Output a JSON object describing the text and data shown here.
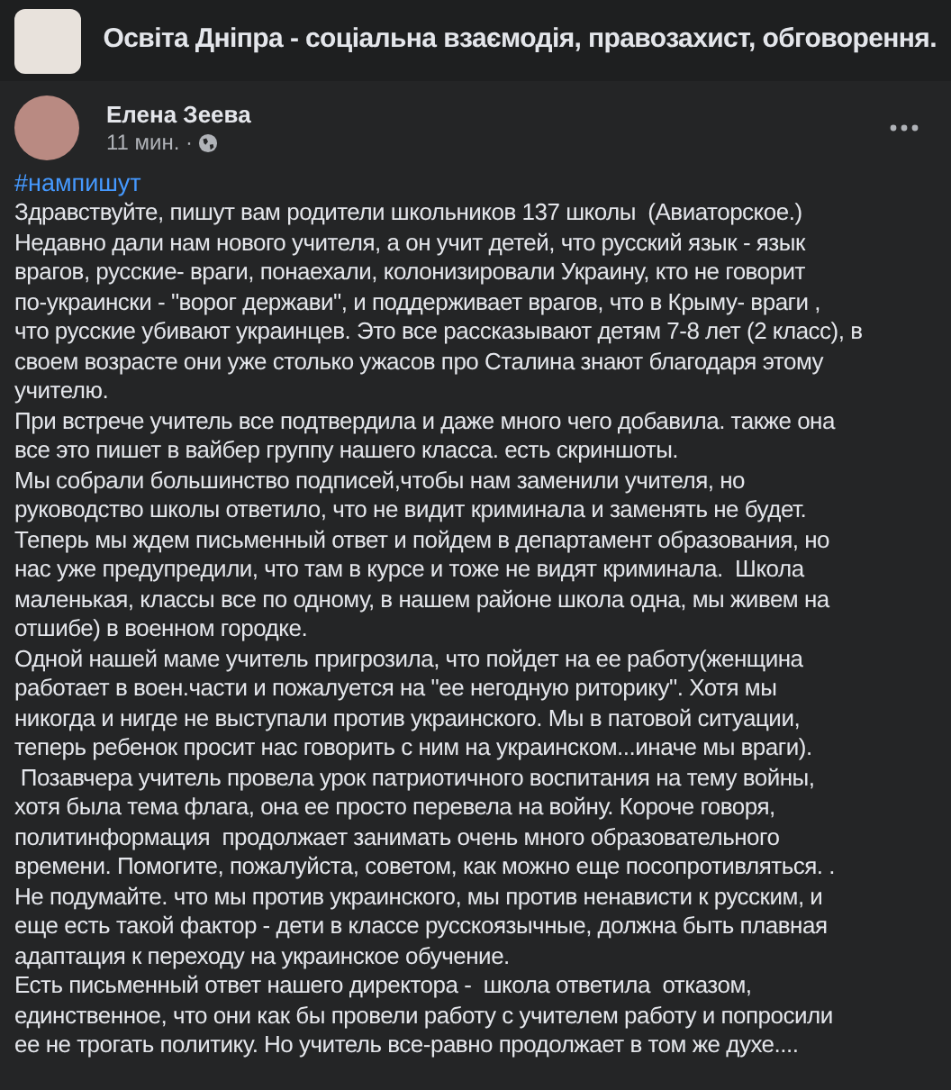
{
  "group": {
    "title": "Освіта Дніпра - соціальна взаємодія, правозахист, обговорення."
  },
  "post": {
    "author": "Елена Зеева",
    "time": "11 мин. ·",
    "hashtag": "#нампишут",
    "lines": [
      "Здравствуйте, пишут вам родители школьников 137 школы  (Авиаторское.)",
      "Недавно дали нам нового учителя, а он учит детей, что русский язык - язык",
      "врагов, русские- враги, понаехали, колонизировали Украину, кто не говорит",
      "по-украински - \"ворог держави\", и поддерживает врагов, что в Крыму- враги ,",
      "что русские убивают украинцев. Это все рассказывают детям 7-8 лет (2 класс), в",
      "своем возрасте они уже столько ужасов про Сталина знают благодаря этому",
      "учителю.",
      "При встрече учитель все подтвердила и даже много чего добавила. также она",
      "все это пишет в вайбер группу нашего класса. есть скриншоты.",
      "Мы собрали большинство подписей,чтобы нам заменили учителя, но",
      "руководство школы ответило, что не видит криминала и заменять не будет.",
      "Теперь мы ждем письменный ответ и пойдем в департамент образования, но",
      "нас уже предупредили, что там в курсе и тоже не видят криминала.  Школа",
      "маленькая, классы все по одному, в нашем районе школа одна, мы живем на",
      "отшибе) в военном городке.",
      "Одной нашей маме учитель пригрозила, что пойдет на ее работу(женщина",
      "работает в воен.части и пожалуется на \"ее негодную риторику\". Хотя мы",
      "никогда и нигде не выступали против украинского. Мы в патовой ситуации,",
      "теперь ребенок просит нас говорить с ним на украинском...иначе мы враги).",
      " Позавчера учитель провела урок патриотичного воспитания на тему войны,",
      "хотя была тема флага, она ее просто перевела на войну. Короче говоря,",
      "политинформация  продолжает занимать очень много образовательного",
      "времени. Помогите, пожалуйста, советом, как можно еще посопротивляться. .",
      "Не подумайте. что мы против украинского, мы против ненависти к русским, и",
      "еще есть такой фактор - дети в классе русскоязычные, должна быть плавная",
      "адаптация к переходу на украинское обучение.",
      "Есть письменный ответ нашего директора -  школа ответила  отказом,",
      "единственное, что они как бы провели работу с учителем работу и попросили",
      "ее не трогать политику. Но учитель все-равно продолжает в том же духе...."
    ]
  }
}
